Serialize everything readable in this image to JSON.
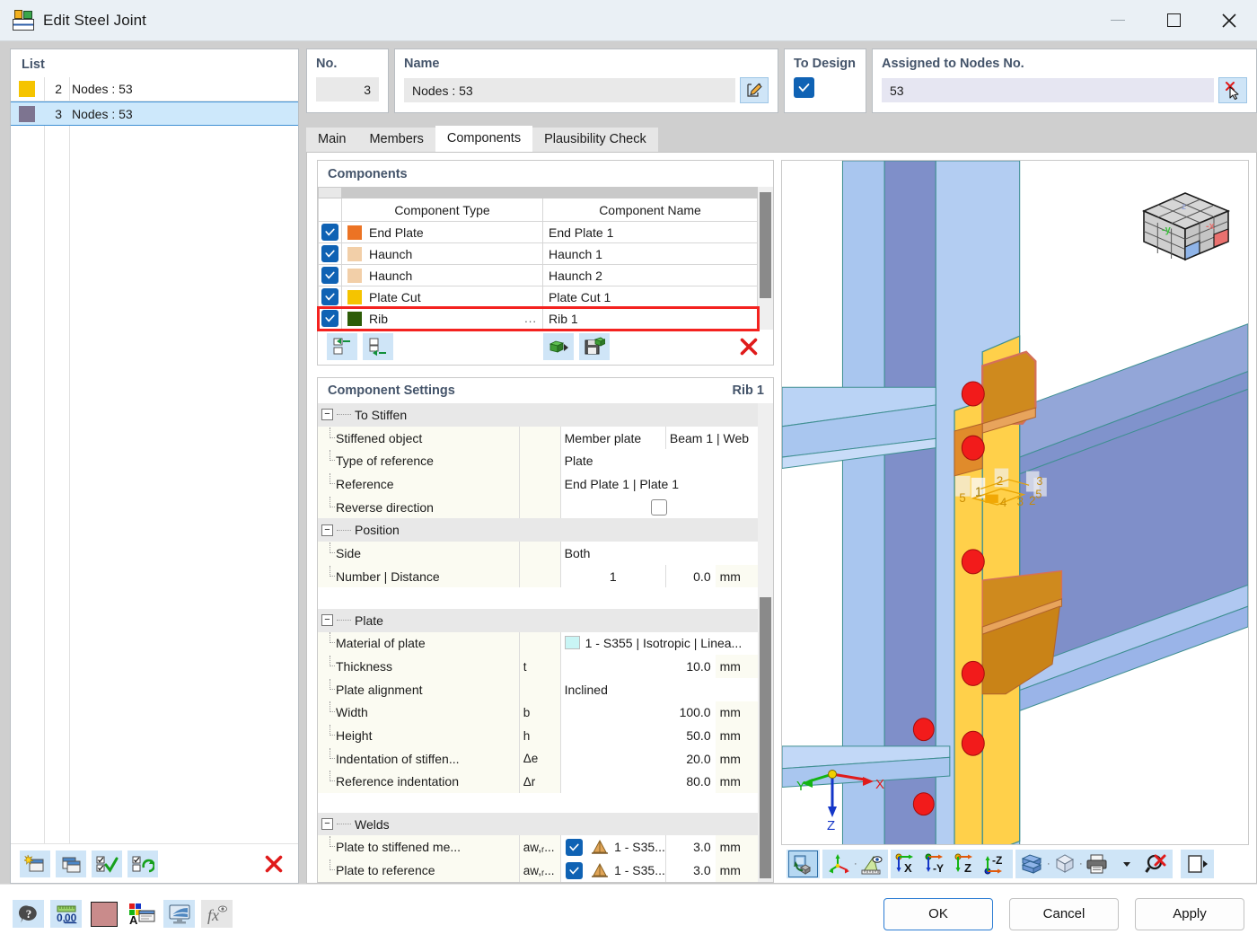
{
  "window": {
    "title": "Edit Steel Joint",
    "icon": "steel-joint-icon",
    "minimize": "minimize-icon",
    "maximize": "maximize-icon",
    "close": "close-icon"
  },
  "list_panel": {
    "title": "List",
    "rows": [
      {
        "color": "#f5c400",
        "no": "2",
        "name": "Nodes : 53",
        "selected": false
      },
      {
        "color": "#7d7490",
        "no": "3",
        "name": "Nodes : 53",
        "selected": true
      }
    ],
    "toolbar": [
      {
        "name": "new-joint-button",
        "icon": "new-window-icon"
      },
      {
        "name": "copy-joint-button",
        "icon": "copy-window-icon"
      },
      {
        "name": "select-all-button",
        "icon": "checkbox-check-icon"
      },
      {
        "name": "invert-selection-button",
        "icon": "checkbox-refresh-icon"
      },
      {
        "name": "delete-joint-button",
        "icon": "red-x-icon"
      }
    ]
  },
  "header": {
    "no_label": "No.",
    "no_value": "3",
    "name_label": "Name",
    "name_value": "Nodes : 53",
    "name_edit_icon": "edit-pencil-icon",
    "to_design_label": "To Design",
    "to_design_checked": true,
    "assigned_label": "Assigned to Nodes No.",
    "assigned_value": "53",
    "assigned_pick_icon": "pick-node-cursor-icon"
  },
  "tabs": [
    {
      "label": "Main",
      "active": false
    },
    {
      "label": "Members",
      "active": false
    },
    {
      "label": "Components",
      "active": true
    },
    {
      "label": "Plausibility Check",
      "active": false
    }
  ],
  "components_panel": {
    "title": "Components",
    "columns": [
      "Component Type",
      "Component Name"
    ],
    "rows": [
      {
        "checked": true,
        "color": "#ec7324",
        "type": "End Plate",
        "name": "End Plate 1",
        "highlighted": false,
        "ellipsis": false
      },
      {
        "checked": true,
        "color": "#f2cfa8",
        "type": "Haunch",
        "name": "Haunch 1",
        "highlighted": false,
        "ellipsis": false
      },
      {
        "checked": true,
        "color": "#f2cfa8",
        "type": "Haunch",
        "name": "Haunch 2",
        "highlighted": false,
        "ellipsis": false
      },
      {
        "checked": true,
        "color": "#f5c400",
        "type": "Plate Cut",
        "name": "Plate Cut 1",
        "highlighted": false,
        "ellipsis": false
      },
      {
        "checked": true,
        "color": "#2d5c07",
        "type": "Rib",
        "name": "Rib 1",
        "highlighted": true,
        "ellipsis": true
      }
    ],
    "toolbar": [
      {
        "name": "move-component-up-button",
        "icon": "indent-out-icon"
      },
      {
        "name": "move-component-down-button",
        "icon": "indent-in-icon"
      },
      {
        "name": "import-component-button",
        "icon": "green-box-arrow-icon"
      },
      {
        "name": "save-component-button",
        "icon": "save-green-icon"
      },
      {
        "name": "delete-component-button",
        "icon": "red-x-icon"
      }
    ]
  },
  "component_settings": {
    "title": "Component Settings",
    "subject": "Rib 1",
    "sections": [
      {
        "name": "To Stiffen",
        "rows": [
          {
            "label": "Stiffened object",
            "symbol": "",
            "value": "Member plate",
            "value2": "Beam 1 | Web",
            "unit": "",
            "kind": "two"
          },
          {
            "label": "Type of reference",
            "symbol": "",
            "value": "Plate",
            "unit": "",
            "kind": "text"
          },
          {
            "label": "Reference",
            "symbol": "",
            "value": "End Plate 1 | Plate 1",
            "unit": "",
            "kind": "text"
          },
          {
            "label": "Reverse direction",
            "symbol": "",
            "value": "",
            "unit": "",
            "kind": "checkbox",
            "checked": false
          }
        ]
      },
      {
        "name": "Position",
        "rows": [
          {
            "label": "Side",
            "symbol": "",
            "value": "Both",
            "unit": "",
            "kind": "text"
          },
          {
            "label": "Number | Distance",
            "symbol": "",
            "value": "1",
            "value2": "0.0",
            "unit": "mm",
            "kind": "numpair"
          }
        ]
      },
      {
        "name": "Plate",
        "rows": [
          {
            "label": "Material of plate",
            "symbol": "",
            "value": "1 - S355 | Isotropic | Linea...",
            "unit": "",
            "kind": "material",
            "swatch": "#c9f5f5"
          },
          {
            "label": "Thickness",
            "symbol": "t",
            "value": "10.0",
            "unit": "mm",
            "kind": "num"
          },
          {
            "label": "Plate alignment",
            "symbol": "",
            "value": "Inclined",
            "unit": "",
            "kind": "text"
          },
          {
            "label": "Width",
            "symbol": "b",
            "value": "100.0",
            "unit": "mm",
            "kind": "num"
          },
          {
            "label": "Height",
            "symbol": "h",
            "value": "50.0",
            "unit": "mm",
            "kind": "num"
          },
          {
            "label": "Indentation of stiffen...",
            "symbol": "Δe",
            "value": "20.0",
            "unit": "mm",
            "kind": "num"
          },
          {
            "label": "Reference indentation",
            "symbol": "Δr",
            "value": "80.0",
            "unit": "mm",
            "kind": "num"
          }
        ]
      },
      {
        "name": "Welds",
        "rows": [
          {
            "label": "Plate to stiffened me...",
            "symbol": "aw,ᵣ...",
            "value": "1 - S35...",
            "value2": "3.0",
            "unit": "mm",
            "kind": "weld",
            "checked": true
          },
          {
            "label": "Plate to reference",
            "symbol": "aw,ᵣ...",
            "value": "1 - S35...",
            "value2": "3.0",
            "unit": "mm",
            "kind": "weld",
            "checked": true
          }
        ]
      }
    ]
  },
  "viewport": {
    "axis_labels": {
      "x": "X",
      "y": "Y",
      "z": "Z"
    },
    "cube_labels": {
      "minus_y": "-y",
      "minus_x": "-x"
    },
    "dim_labels": [
      "5",
      "4",
      "1",
      "2",
      "3",
      "2",
      "5",
      "3"
    ],
    "toolbar": [
      {
        "name": "rotate-view-button",
        "icon": "rotate-object-icon",
        "selected": true
      },
      {
        "name": "axis-view-button",
        "icon": "axis-tripod-icon"
      },
      {
        "name": "measure-button",
        "icon": "ruler-eye-icon"
      },
      {
        "name": "view-x-button",
        "icon": "view-in-x-icon",
        "label": "X"
      },
      {
        "name": "view-minus-y-button",
        "icon": "view-in-minus-y-icon",
        "label": "-Y"
      },
      {
        "name": "view-z-button",
        "icon": "view-in-z-icon",
        "label": "Z"
      },
      {
        "name": "view-minus-z-button",
        "icon": "view-in-minus-z-icon",
        "label": "-Z"
      },
      {
        "name": "shading-button",
        "icon": "solid-blocks-icon"
      },
      {
        "name": "wireframe-button",
        "icon": "wireframe-cube-icon"
      },
      {
        "name": "print-button",
        "icon": "printer-icon"
      },
      {
        "name": "print-dropdown",
        "icon": "chevron-down-icon"
      },
      {
        "name": "reset-zoom-button",
        "icon": "magnifier-red-x-icon"
      },
      {
        "name": "expand-view-button",
        "icon": "panel-expand-icon"
      }
    ]
  },
  "footer": {
    "tools": [
      {
        "name": "help-button",
        "icon": "question-balloon-icon"
      },
      {
        "name": "units-button",
        "icon": "units-decimal-icon"
      },
      {
        "name": "color-button",
        "icon": "color-swatch-icon",
        "color": "#c98b8b"
      },
      {
        "name": "display-properties-button",
        "icon": "colors-text-icon"
      },
      {
        "name": "view-settings-button",
        "icon": "monitor-icon"
      },
      {
        "name": "formula-button",
        "icon": "fx-icon"
      }
    ],
    "buttons": [
      {
        "name": "ok-button",
        "label": "OK",
        "primary": true
      },
      {
        "name": "cancel-button",
        "label": "Cancel",
        "primary": false
      },
      {
        "name": "apply-button",
        "label": "Apply",
        "primary": false
      }
    ]
  }
}
